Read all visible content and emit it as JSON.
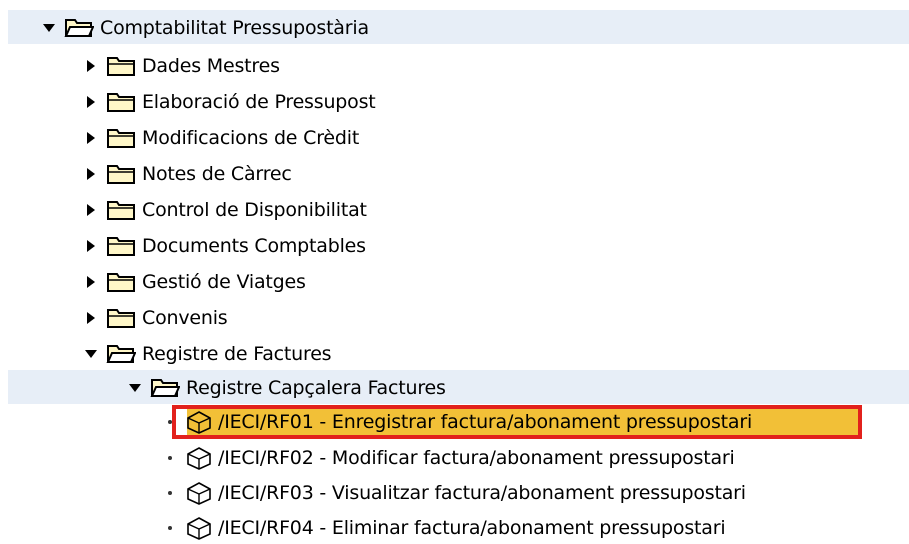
{
  "colors": {
    "band": "#e7eef7",
    "selection": "#f2c037",
    "highlight_border": "#e2211c",
    "folder_fill": "#fff7c8",
    "folder_outline": "#000000"
  },
  "tree": {
    "root": {
      "label": "Comptabilitat Pressupostària",
      "expanded": true,
      "icon": "folder-open-icon"
    },
    "folders": [
      {
        "label": "Dades Mestres",
        "expanded": false,
        "icon": "folder-icon"
      },
      {
        "label": "Elaboració de Pressupost",
        "expanded": false,
        "icon": "folder-icon"
      },
      {
        "label": "Modificacions de Crèdit",
        "expanded": false,
        "icon": "folder-icon"
      },
      {
        "label": "Notes de Càrrec",
        "expanded": false,
        "icon": "folder-icon"
      },
      {
        "label": "Control de Disponibilitat",
        "expanded": false,
        "icon": "folder-icon"
      },
      {
        "label": "Documents Comptables",
        "expanded": false,
        "icon": "folder-icon"
      },
      {
        "label": "Gestió de Viatges",
        "expanded": false,
        "icon": "folder-icon"
      },
      {
        "label": "Convenis",
        "expanded": false,
        "icon": "folder-icon"
      }
    ],
    "registre": {
      "label": "Registre de Factures",
      "expanded": true,
      "icon": "folder-open-icon"
    },
    "capcalera": {
      "label": "Registre Capçalera Factures",
      "expanded": true,
      "icon": "folder-open-icon"
    },
    "transactions": [
      {
        "label": "/IECI/RF01 - Enregistrar factura/abonament pressupostari",
        "selected": true,
        "icon": "transaction-cube-icon"
      },
      {
        "label": "/IECI/RF02 - Modificar factura/abonament pressupostari",
        "selected": false,
        "icon": "transaction-cube-icon"
      },
      {
        "label": "/IECI/RF03 - Visualitzar factura/abonament pressupostari",
        "selected": false,
        "icon": "transaction-cube-icon"
      },
      {
        "label": "/IECI/RF04 - Eliminar factura/abonament pressupostari",
        "selected": false,
        "icon": "transaction-cube-icon"
      }
    ]
  }
}
